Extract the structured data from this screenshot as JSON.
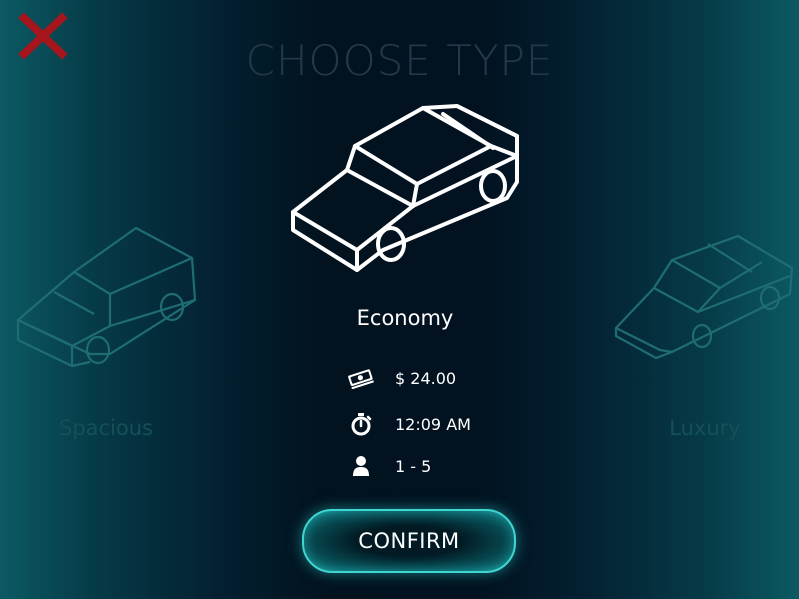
{
  "header": {
    "title": "CHOOSE TYPE",
    "close_icon": "close-x-icon"
  },
  "types": {
    "previous": {
      "label": "Spacious",
      "icon": "suv-icon"
    },
    "selected": {
      "label": "Economy",
      "icon": "sedan-icon"
    },
    "next": {
      "label": "Luxury",
      "icon": "sports-car-icon"
    }
  },
  "details": {
    "price": {
      "icon": "money-icon",
      "value": "$ 24.00"
    },
    "time": {
      "icon": "stopwatch-icon",
      "value": "12:09 AM"
    },
    "passengers": {
      "icon": "person-icon",
      "value": "1 - 5"
    }
  },
  "actions": {
    "confirm_label": "CONFIRM"
  },
  "colors": {
    "close": "#a5151b",
    "accent": "#3fd6d0",
    "title": "#23394a",
    "inactive_label": "#145057"
  }
}
